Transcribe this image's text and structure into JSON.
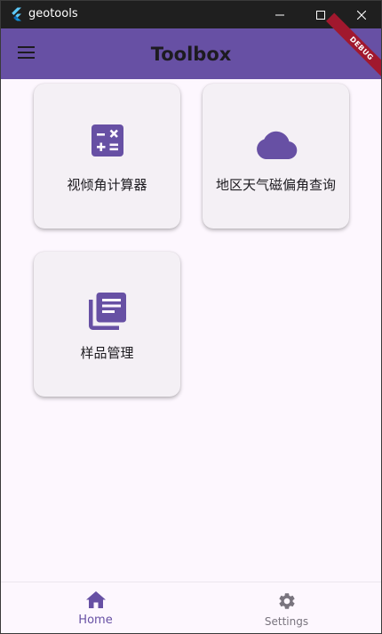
{
  "window": {
    "title": "geotools",
    "icons": {
      "app": "flutter-logo-icon",
      "minimize": "minimize-icon",
      "maximize": "maximize-icon",
      "close": "close-icon"
    }
  },
  "appbar": {
    "title": "Toolbox",
    "menu_icon": "hamburger-menu-icon",
    "debug_banner": "DEBUG",
    "colors": {
      "background": "#6750a4",
      "banner": "#a1182e"
    }
  },
  "tools": [
    {
      "label": "视倾角计算器",
      "icon": "calculator-icon"
    },
    {
      "label": "地区天气磁偏角查询",
      "icon": "cloud-icon"
    },
    {
      "label": "样品管理",
      "icon": "library-books-icon"
    }
  ],
  "bottom_nav": {
    "selected": "Home",
    "items": [
      {
        "label": "Home",
        "icon": "home-icon"
      },
      {
        "label": "Settings",
        "icon": "settings-gear-icon"
      }
    ]
  },
  "colors": {
    "accent": "#6750a4",
    "surface": "#fdf7fe",
    "card": "#f4f0f5",
    "inactive": "#79747e"
  }
}
